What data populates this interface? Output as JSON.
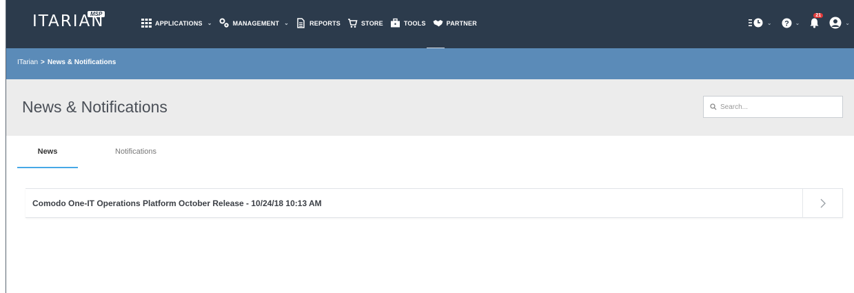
{
  "brand": {
    "name": "ITARIAN",
    "badge": "MSP"
  },
  "nav": [
    {
      "label": "APPLICATIONS",
      "icon": "grid-icon",
      "has_dropdown": true
    },
    {
      "label": "MANAGEMENT",
      "icon": "gears-icon",
      "has_dropdown": true
    },
    {
      "label": "REPORTS",
      "icon": "document-icon",
      "has_dropdown": false
    },
    {
      "label": "STORE",
      "icon": "cart-icon",
      "has_dropdown": false
    },
    {
      "label": "TOOLS",
      "icon": "toolbox-icon",
      "has_dropdown": false
    },
    {
      "label": "PARTNER",
      "icon": "handshake-icon",
      "has_dropdown": false
    }
  ],
  "header_right": {
    "notification_count": "21"
  },
  "breadcrumb": {
    "root": "ITarian",
    "separator": ">",
    "current": "News & Notifications"
  },
  "page": {
    "title": "News & Notifications",
    "search_placeholder": "Search..."
  },
  "tabs": [
    {
      "label": "News",
      "active": true
    },
    {
      "label": "Notifications",
      "active": false
    }
  ],
  "news": [
    {
      "title": "Comodo One-IT Operations Platform October Release - 10/24/18 10:13 AM"
    }
  ],
  "colors": {
    "topbar": "#2c3b4c",
    "breadcrumb_bar": "#5b8bb8",
    "tab_accent": "#46a8e6",
    "badge": "#e23a3a"
  }
}
